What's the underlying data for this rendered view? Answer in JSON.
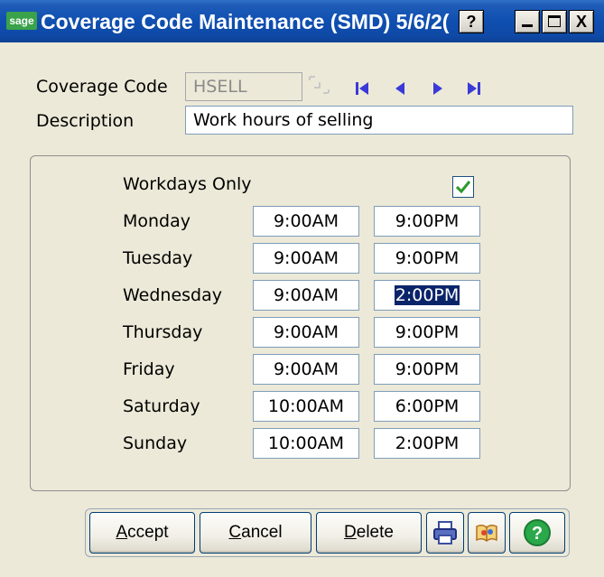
{
  "window": {
    "logo": "sage",
    "title": "Coverage Code Maintenance (SMD) 5/6/2(",
    "help_glyph": "?",
    "minimize_glyph": "_",
    "maximize_glyph": "□",
    "close_glyph": "X"
  },
  "coverage_code": {
    "label": "Coverage Code",
    "value": "HSELL"
  },
  "description": {
    "label": "Description",
    "value": "Work hours of selling"
  },
  "workdays_only": {
    "label": "Workdays Only",
    "checked": true
  },
  "schedule": [
    {
      "day": "Monday",
      "start": "9:00AM",
      "end": "9:00PM"
    },
    {
      "day": "Tuesday",
      "start": "9:00AM",
      "end": "9:00PM"
    },
    {
      "day": "Wednesday",
      "start": "9:00AM",
      "end": "2:00PM"
    },
    {
      "day": "Thursday",
      "start": "9:00AM",
      "end": "9:00PM"
    },
    {
      "day": "Friday",
      "start": "9:00AM",
      "end": "9:00PM"
    },
    {
      "day": "Saturday",
      "start": "10:00AM",
      "end": "6:00PM"
    },
    {
      "day": "Sunday",
      "start": "10:00AM",
      "end": "2:00PM"
    }
  ],
  "buttons": {
    "accept": {
      "first": "A",
      "rest": "ccept"
    },
    "cancel": {
      "first": "C",
      "rest": "ancel"
    },
    "delete": {
      "first": "D",
      "rest": "elete"
    }
  },
  "icons": {
    "lookup": "lookup-icon",
    "first": "first-record-icon",
    "previous": "previous-record-icon",
    "next": "next-record-icon",
    "last": "last-record-icon",
    "print": "printer-icon",
    "book": "book-icon",
    "help": "help-icon"
  },
  "colors": {
    "titlebar": "#0f4fb0",
    "nav_arrows": "#3a3ad8",
    "selection": "#0a246a",
    "check": "#2a9a2a",
    "help_green": "#2aa84a"
  }
}
